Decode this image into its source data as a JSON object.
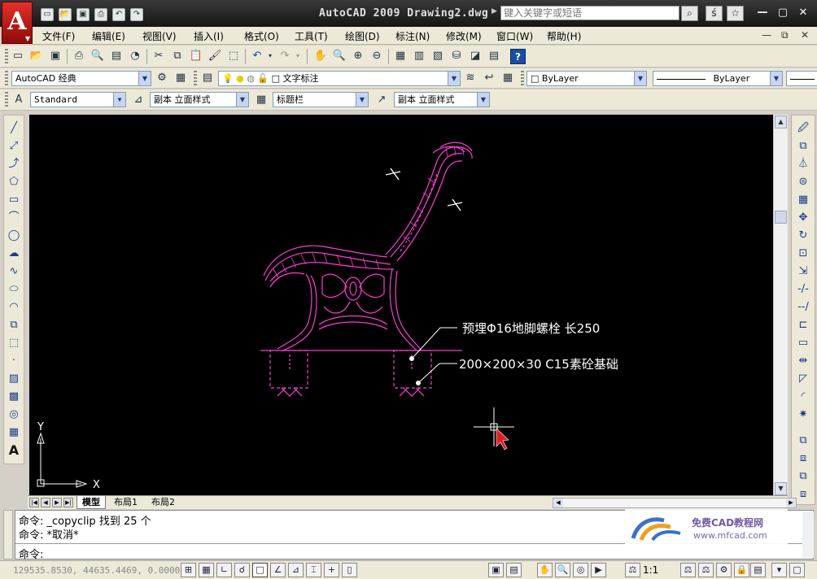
{
  "window": {
    "title": "AutoCAD 2009 Drawing2.dwg",
    "search_placeholder": "键入关键字或短语",
    "logo_letter": "A"
  },
  "menu": {
    "items": [
      "文件(F)",
      "编辑(E)",
      "视图(V)",
      "插入(I)",
      "格式(O)",
      "工具(T)",
      "绘图(D)",
      "标注(N)",
      "修改(M)",
      "窗口(W)",
      "帮助(H)"
    ]
  },
  "toolbars": {
    "workspace": "AutoCAD 经典",
    "layer": "文字标注",
    "color": "ByLayer",
    "linetype": "ByLayer",
    "text_style": "Standard",
    "dim_style": "副本 立面样式",
    "table_style": "标题栏",
    "multileader_style": "副本 立面样式"
  },
  "drawing": {
    "label_bolt": "预埋Φ16地脚螺栓 长250",
    "label_foundation": "200×200×30 C15素砼基础",
    "axis_x": "X",
    "axis_y": "Y",
    "colors": {
      "line": "#ff3cd6",
      "white": "#ffffff",
      "background": "#000000"
    }
  },
  "tabs": [
    "模型",
    "布局1",
    "布局2"
  ],
  "command": {
    "line1": "命令: _copyclip 找到 25 个",
    "line2": "命令: *取消*",
    "prompt": "命令:"
  },
  "watermark": {
    "title": "免费CAD教程网",
    "url": "www.mfcad.com"
  },
  "status": {
    "coords": "129535.8530, 44635.4469, 0.0000",
    "scale": "1:1"
  }
}
